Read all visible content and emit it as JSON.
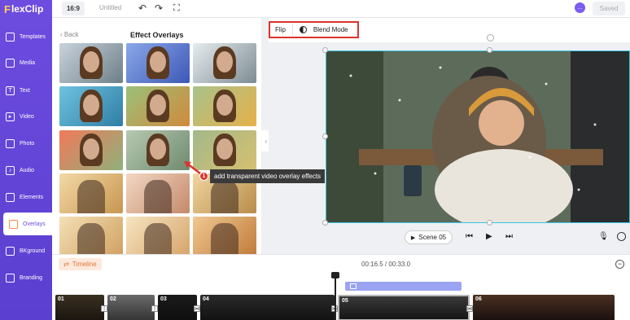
{
  "app": {
    "logo_text": "lexClip",
    "logo_mark": "F"
  },
  "sidebar": {
    "items": [
      {
        "label": "Templates",
        "icon": "layers-icon"
      },
      {
        "label": "Media",
        "icon": "media-icon"
      },
      {
        "label": "Text",
        "icon": "text-icon"
      },
      {
        "label": "Video",
        "icon": "video-icon"
      },
      {
        "label": "Photo",
        "icon": "photo-icon"
      },
      {
        "label": "Audio",
        "icon": "audio-icon"
      },
      {
        "label": "Elements",
        "icon": "elements-icon"
      },
      {
        "label": "Overlays",
        "icon": "overlays-icon",
        "active": true
      },
      {
        "label": "BKground",
        "icon": "background-icon"
      },
      {
        "label": "Branding",
        "icon": "branding-icon"
      }
    ]
  },
  "topbar": {
    "ratio": "16:9",
    "title": "Untitled",
    "saved": "Saved"
  },
  "panel": {
    "back": "Back",
    "title": "Effect Overlays"
  },
  "toolbar": {
    "flip": "Flip",
    "blend_mode": "Blend Mode"
  },
  "annotation": {
    "number": "1",
    "text": "add transparent video overlay effects"
  },
  "playback": {
    "scene": "Scene 05"
  },
  "timeline": {
    "label": "Timeline",
    "time": "00:16.5 / 00:33.0",
    "clips": [
      "01",
      "02",
      "03",
      "04",
      "05",
      "06"
    ]
  },
  "colors": {
    "accent": "#6d4ce0",
    "highlight": "#d9342b",
    "selection": "#38c6e0"
  }
}
